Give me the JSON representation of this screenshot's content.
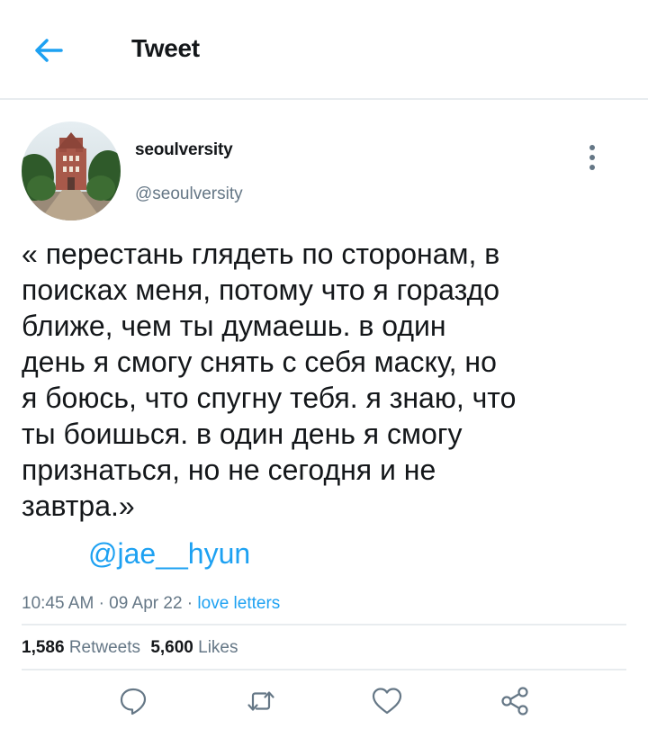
{
  "header": {
    "back_icon": "arrow-left-icon",
    "title": "Tweet",
    "accent_color": "#1da1f2"
  },
  "tweet": {
    "display_name": "seoulversity",
    "handle": "@seoulversity",
    "text": "« перестань глядеть по сторонам, в\nпоисках меня, потому что я гораздо\nближе, чем ты думаешь. в один\nдень я смогу снять с себя маску, но\nя боюсь, что спугну тебя. я знаю, что\nты боишься. в один день я смогу\nпризнаться, но не сегодня и не\nзавтра.»",
    "mention": "@jae__hyun",
    "time": "10:45 AM",
    "date": "09 Apr 22",
    "source": "love letters"
  },
  "stats": {
    "retweets_count": "1,586",
    "retweets_label": "Retweets",
    "likes_count": "5,600",
    "likes_label": "Likes"
  },
  "actions": {
    "reply_icon": "reply-icon",
    "retweet_icon": "retweet-icon",
    "like_icon": "heart-icon",
    "share_icon": "share-icon"
  }
}
